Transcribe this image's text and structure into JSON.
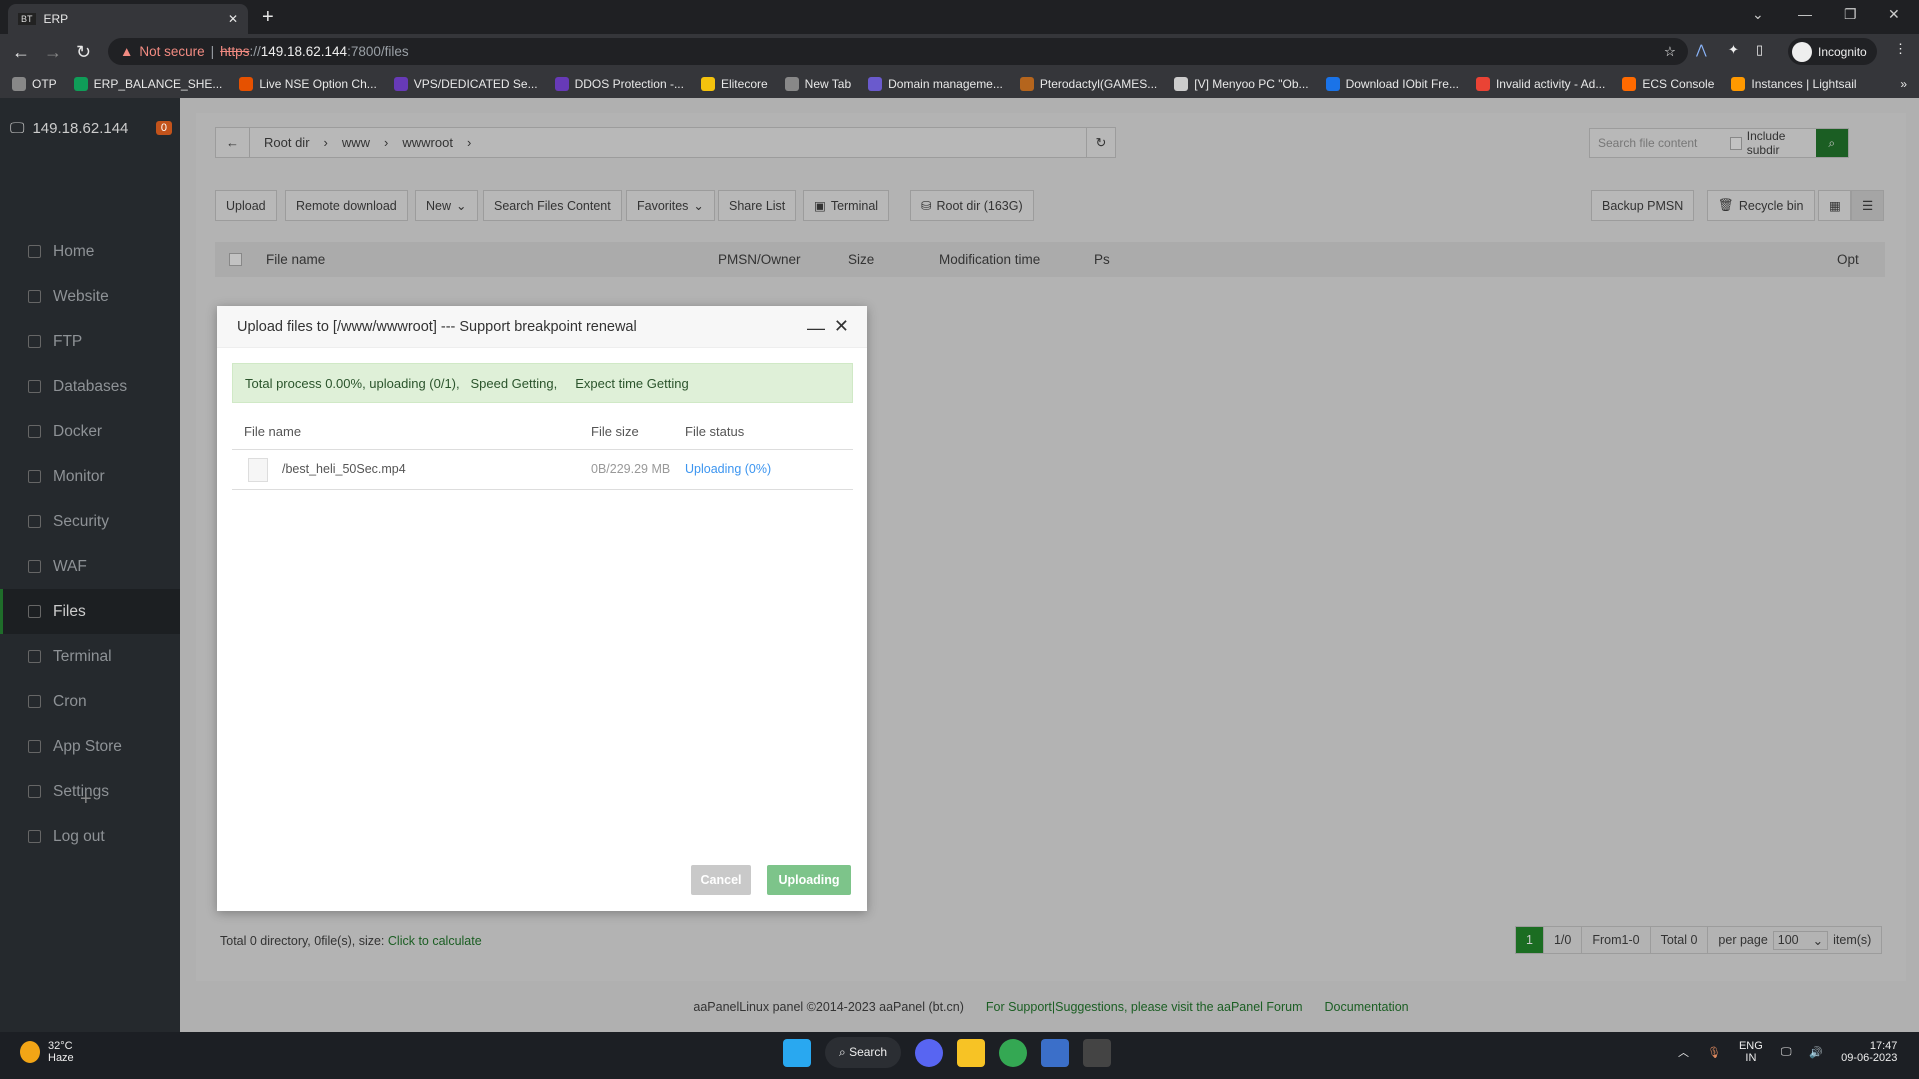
{
  "browser": {
    "tab_favicon": "BT",
    "tab_title": "ERP",
    "not_secure": "Not secure",
    "url_scheme": "https",
    "url_host": "149.18.62.144",
    "url_rest": ":7800/files",
    "profile": "Incognito",
    "bookmarks": [
      {
        "label": "OTP",
        "color": "#888"
      },
      {
        "label": "ERP_BALANCE_SHE...",
        "color": "#0f9d58"
      },
      {
        "label": "Live NSE Option Ch...",
        "color": "#e65100"
      },
      {
        "label": "VPS/DEDICATED Se...",
        "color": "#673ab7"
      },
      {
        "label": "DDOS Protection -...",
        "color": "#673ab7"
      },
      {
        "label": "Elitecore",
        "color": "#f4c20d"
      },
      {
        "label": "New Tab",
        "color": "#888"
      },
      {
        "label": "Domain manageme...",
        "color": "#6a5acd"
      },
      {
        "label": "Pterodactyl(GAMES...",
        "color": "#b5651d"
      },
      {
        "label": "[V] Menyoo PC \"Ob...",
        "color": "#ccc"
      },
      {
        "label": "Download IObit Fre...",
        "color": "#1a73e8"
      },
      {
        "label": "Invalid activity - Ad...",
        "color": "#ea4335"
      },
      {
        "label": "ECS Console",
        "color": "#ff6a00"
      },
      {
        "label": "Instances | Lightsail",
        "color": "#ff9900"
      }
    ]
  },
  "sidebar": {
    "server": "149.18.62.144",
    "badge": "0",
    "items": [
      {
        "label": "Home"
      },
      {
        "label": "Website"
      },
      {
        "label": "FTP"
      },
      {
        "label": "Databases"
      },
      {
        "label": "Docker"
      },
      {
        "label": "Monitor"
      },
      {
        "label": "Security"
      },
      {
        "label": "WAF"
      },
      {
        "label": "Files",
        "active": true
      },
      {
        "label": "Terminal"
      },
      {
        "label": "Cron"
      },
      {
        "label": "App Store"
      },
      {
        "label": "Settings"
      },
      {
        "label": "Log out"
      }
    ],
    "add": "+"
  },
  "files": {
    "breadcrumb": [
      "Root dir",
      "www",
      "wwwroot"
    ],
    "search_placeholder": "Search file content",
    "include_subdir": "Include subdir",
    "toolbar": [
      "Upload",
      "Remote download",
      "New",
      "Search Files Content",
      "Favorites",
      "Share List",
      "Terminal",
      "Root dir (163G)"
    ],
    "backup": "Backup PMSN",
    "recycle": "Recycle bin",
    "columns": [
      "File name",
      "PMSN/Owner",
      "Size",
      "Modification time",
      "Ps",
      "Opt"
    ],
    "summary": "Total 0 directory, 0file(s), size: ",
    "calc_link": "Click to calculate",
    "pager": {
      "current": "1",
      "pages": "1/0",
      "range": "From1-0",
      "total": "Total 0",
      "per_page_label": "per page",
      "per_page": "100",
      "items": "item(s)"
    }
  },
  "footer": {
    "copyright": "aaPanelLinux panel ©2014-2023 aaPanel (bt.cn)",
    "support": "For Support|Suggestions, please visit the aaPanel Forum",
    "docs": "Documentation"
  },
  "modal": {
    "title": "Upload files to [/www/wwwroot] --- Support breakpoint renewal",
    "status": "Total process 0.00%, uploading (0/1),   Speed Getting,     Expect time Getting",
    "columns": [
      "File name",
      "File size",
      "File status"
    ],
    "file": {
      "name": "/best_heli_50Sec.mp4",
      "size": "0B/229.29 MB",
      "status": "Uploading (0%)"
    },
    "cancel": "Cancel",
    "upload": "Uploading"
  },
  "taskbar": {
    "temp": "32°C",
    "weather": "Haze",
    "search": "Search",
    "lang1": "ENG",
    "lang2": "IN",
    "time": "17:47",
    "date": "09-06-2023"
  }
}
